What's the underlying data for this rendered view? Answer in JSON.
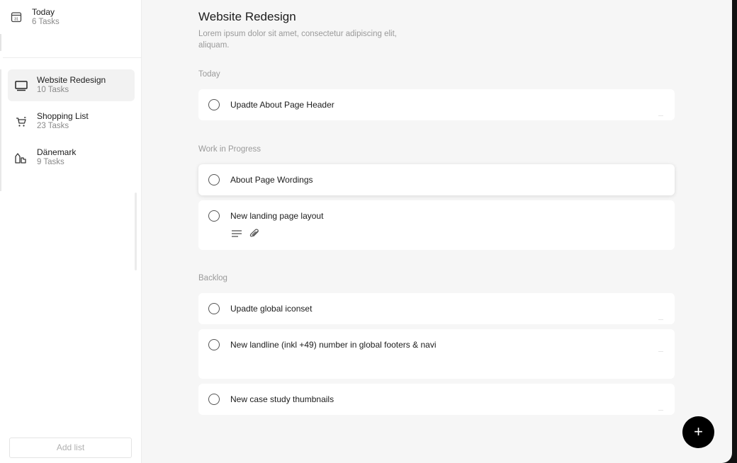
{
  "sidebar": {
    "today": {
      "label": "Today",
      "count": "6 Tasks",
      "icon": "calendar-icon"
    },
    "lists": [
      {
        "label": "Website Redesign",
        "count": "10 Tasks",
        "icon": "monitor-icon",
        "active": true
      },
      {
        "label": "Shopping List",
        "count": "23 Tasks",
        "icon": "cart-icon",
        "active": false
      },
      {
        "label": "Dänemark",
        "count": "9 Tasks",
        "icon": "buildings-icon",
        "active": false
      }
    ],
    "add_list_label": "Add list"
  },
  "main": {
    "title": "Website Redesign",
    "description": "Lorem ipsum dolor sit amet, consectetur adipiscing elit, aliquam.",
    "sections": [
      {
        "label": "Today",
        "tasks": [
          {
            "label": "Upadte About Page Header"
          }
        ]
      },
      {
        "label": "Work in Progress",
        "tasks": [
          {
            "label": "About Page Wordings"
          },
          {
            "label": "New landing page layout",
            "meta_icons": [
              "notes-icon",
              "attachment-icon"
            ]
          }
        ]
      },
      {
        "label": "Backlog",
        "tasks": [
          {
            "label": "Upadte global iconset"
          },
          {
            "label": "New landline (inkl +49) number in global footers & navi"
          },
          {
            "label": "New case study thumbnails"
          }
        ]
      }
    ]
  },
  "fab": {
    "label": "+",
    "icon": "plus-icon"
  },
  "colors": {
    "fab": "#000000",
    "background": "#f6f6f6",
    "card": "#ffffff",
    "active_list": "#f2f2f2"
  }
}
